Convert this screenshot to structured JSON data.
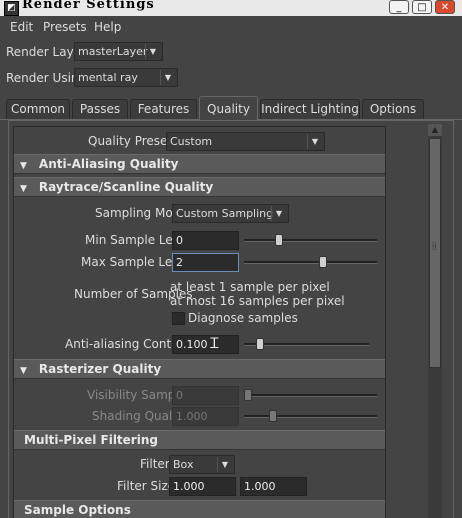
{
  "window": {
    "title": "Render Settings",
    "icon": "maya-icon",
    "minimize": "_",
    "maximize": "□",
    "close": "✕"
  },
  "menubar": {
    "items": [
      "Edit",
      "Presets",
      "Help"
    ]
  },
  "render_layer": {
    "label": "Render Layer",
    "value": "masterLayer"
  },
  "render_using": {
    "label": "Render Using",
    "value": "mental ray"
  },
  "tabs": {
    "items": [
      "Common",
      "Passes",
      "Features",
      "Quality",
      "Indirect Lighting",
      "Options"
    ],
    "active": "Quality"
  },
  "quality_presets": {
    "label": "Quality Presets",
    "value": "Custom"
  },
  "sections": {
    "anti_aliasing": "Anti-Aliasing Quality",
    "raytrace": "Raytrace/Scanline Quality",
    "rasterizer": "Rasterizer Quality",
    "multipixel": "Multi-Pixel Filtering",
    "sample_options": "Sample Options"
  },
  "sampling_mode": {
    "label": "Sampling Mode",
    "value": "Custom Sampling"
  },
  "min_sample_level": {
    "label": "Min Sample Level",
    "value": "0"
  },
  "max_sample_level": {
    "label": "Max Sample Level",
    "value": "2"
  },
  "number_of_samples": {
    "label": "Number of Samples",
    "line1": "at least 1 sample per pixel",
    "line2": "at most 16 samples per pixel"
  },
  "diagnose_samples": {
    "label": "Diagnose samples",
    "checked": false
  },
  "anti_aliasing_contrast": {
    "label": "Anti-aliasing Contrast",
    "value": "0.100"
  },
  "visibility_samples": {
    "label": "Visibility Samples",
    "value": "0"
  },
  "shading_quality": {
    "label": "Shading Quality",
    "value": "1.000"
  },
  "filter": {
    "label": "Filter",
    "value": "Box"
  },
  "filter_size": {
    "label": "Filter Size",
    "value1": "1.000",
    "value2": "1.000"
  },
  "sliders": {
    "min_sample_level": 0.25,
    "max_sample_level": 0.6,
    "anti_aliasing_contrast": 0.1,
    "visibility_samples": 0.0,
    "shading_quality": 0.2
  },
  "colors": {
    "background": "#444444",
    "section_header": "#5a5a5a",
    "close_button": "#d84a2f",
    "focus_border": "#6b8fb8"
  }
}
